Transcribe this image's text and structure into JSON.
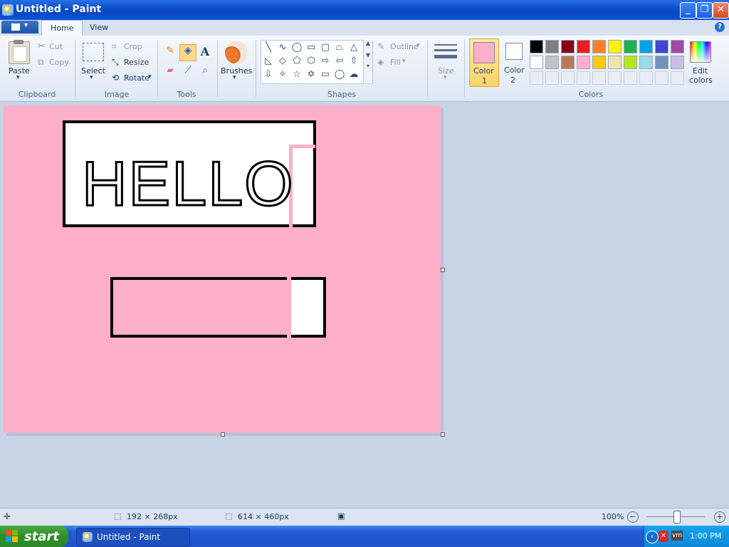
{
  "window": {
    "title": "Untitled - Paint"
  },
  "tabs": [
    {
      "label": "Home"
    },
    {
      "label": "View"
    }
  ],
  "clipboard": {
    "paste": "Paste",
    "cut": "Cut",
    "copy": "Copy",
    "group": "Clipboard"
  },
  "image": {
    "select": "Select",
    "crop": "Crop",
    "resize": "Resize",
    "rotate": "Rotate",
    "group": "Image"
  },
  "tools": {
    "group": "Tools",
    "brushes": "Brushes"
  },
  "shapes": {
    "outline": "Outline",
    "fill": "Fill",
    "group": "Shapes"
  },
  "size": {
    "label": "Size"
  },
  "colors": {
    "color1_label_a": "Color",
    "color1_label_b": "1",
    "color2_label_a": "Color",
    "color2_label_b": "2",
    "edit_a": "Edit",
    "edit_b": "colors",
    "group": "Colors",
    "color1": "#ffafc9",
    "color2": "#ffffff",
    "palette_row1": [
      "#000000",
      "#7f7f7f",
      "#880015",
      "#ed1c24",
      "#ff7f27",
      "#fff200",
      "#22b14c",
      "#00a2e8",
      "#3f48cc",
      "#a349a4"
    ],
    "palette_row2": [
      "#ffffff",
      "#c3c3c3",
      "#b97a57",
      "#ffaec9",
      "#ffc90e",
      "#efe4b0",
      "#b5e61d",
      "#99d9ea",
      "#7092be",
      "#c8bfe7"
    ]
  },
  "canvas": {
    "text": "HELLO"
  },
  "status": {
    "selection_size": "192 × 268px",
    "image_size": "614 × 460px",
    "zoom": "100%"
  },
  "taskbar": {
    "start": "start",
    "task_item": "Untitled - Paint",
    "clock": "1:00 PM"
  }
}
